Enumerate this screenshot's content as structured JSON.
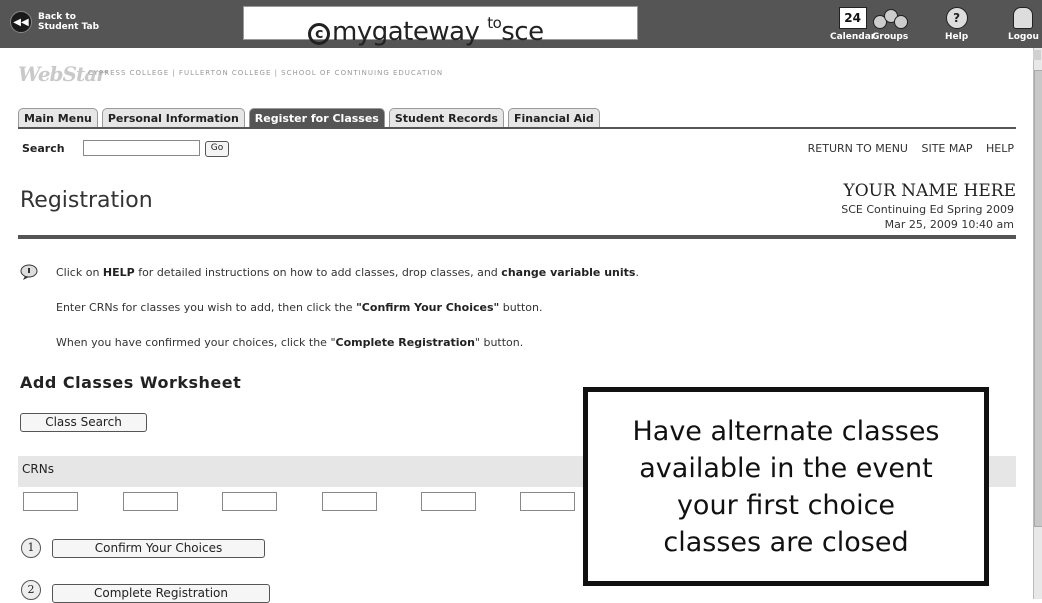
{
  "topbar": {
    "back_label_line1": "Back to",
    "back_label_line2": "Student Tab",
    "banner_brand": "mygateway",
    "banner_to": "to",
    "banner_suffix": "sce",
    "calendar_day": "24",
    "calendar_label": "Calendar",
    "groups_label": "Groups",
    "help_label": "Help",
    "logout_label": "Logou"
  },
  "header": {
    "logo": "WebStar",
    "colleges": "CYPRESS COLLEGE | FULLERTON COLLEGE | SCHOOL OF CONTINUING EDUCATION"
  },
  "tabs": [
    {
      "label": "Main Menu"
    },
    {
      "label": "Personal Information"
    },
    {
      "label": "Register for Classes",
      "active": true
    },
    {
      "label": "Student Records"
    },
    {
      "label": "Financial Aid"
    }
  ],
  "search": {
    "label": "Search",
    "value": "",
    "go_label": "Go"
  },
  "toplinks": {
    "return": "RETURN TO MENU",
    "sitemap": "SITE MAP",
    "help": "HELP"
  },
  "page": {
    "title": "Registration",
    "user_name": "YOUR NAME HERE",
    "term": "SCE Continuing Ed Spring 2009",
    "datetime": "Mar 25, 2009 10:40 am"
  },
  "info": {
    "line1_a": "Click on ",
    "line1_b": "HELP",
    "line1_c": " for detailed instructions on how to add classes, drop classes, and ",
    "line1_d": "change variable units",
    "line1_e": ".",
    "line2_a": "Enter CRNs for classes you wish to add, then click the ",
    "line2_b": "\"Confirm Your Choices\"",
    "line2_c": " button.",
    "line3_a": "When you have confirmed your choices, click the \"",
    "line3_b": "Complete Registration",
    "line3_c": "\" button."
  },
  "worksheet": {
    "title": "Add Classes Worksheet",
    "class_search": "Class Search",
    "crn_label": "CRNs",
    "step1_num": "1",
    "confirm_label": "Confirm Your Choices",
    "step2_num": "2",
    "complete_label": "Complete Registration"
  },
  "callout": {
    "line1": "Have alternate classes",
    "line2": "available in the event",
    "line3": "your first choice",
    "line4": "classes are closed"
  }
}
